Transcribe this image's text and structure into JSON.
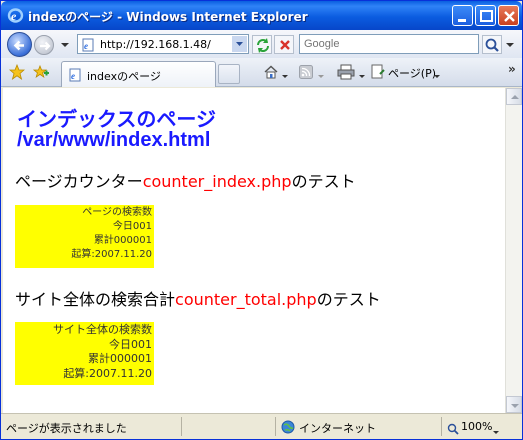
{
  "window": {
    "title": "indexのページ - Windows Internet Explorer"
  },
  "toolbar": {
    "address": "http://192.168.1.48/",
    "search_placeholder": "Google",
    "tab_label": "indexのページ",
    "page_menu_label": "ページ(P)",
    "more_chevron": "»"
  },
  "content": {
    "heading_line1": "インデックスのページ",
    "heading_line2": "/var/www/index.html",
    "section1": {
      "prefix": "ページカウンター",
      "link": "counter_index.php",
      "suffix": "のテスト",
      "box": [
        "ページの検索数",
        "今日001",
        "累計000001",
        "起算:2007.11.20"
      ]
    },
    "section2": {
      "prefix": "サイト全体の検索合計",
      "link": "counter_total.php",
      "suffix": "のテスト",
      "box": [
        "サイト全体の検索数",
        "今日001",
        "累計000001",
        "起算:2007.11.20"
      ]
    }
  },
  "statusbar": {
    "status_text": "ページが表示されました",
    "zone": "インターネット",
    "zoom": "100%"
  },
  "colors": {
    "heading": "#1a1aff",
    "link_text": "#ff0000",
    "counter_box": "#ffff00"
  }
}
